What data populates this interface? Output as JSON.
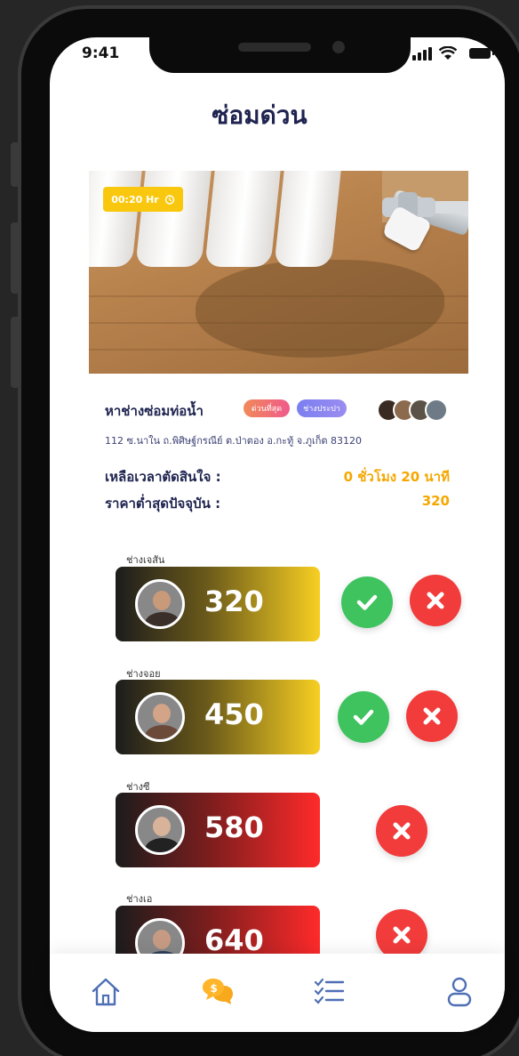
{
  "status": {
    "time": "9:41"
  },
  "header": {
    "title": "ซ่อมด่วน"
  },
  "hero": {
    "timer": "00:20 Hr"
  },
  "job": {
    "title": "หาช่างซ่อมท่อน้ำ",
    "tags": [
      "ด่วนที่สุด",
      "ช่างประปา"
    ],
    "address": "112 ซ.นาใน ถ.พิศิษฐ์กรณีย์ ต.ป่าตอง อ.กะทู้ จ.ภูเก็ต 83120"
  },
  "info": {
    "time_left_label": "เหลือเวลาตัดสินใจ :",
    "time_left_value": "0 ชั่วโมง 20 นาที",
    "lowest_price_label": "ราคาต่ำสุดปัจจุบัน :",
    "lowest_price_value": "320"
  },
  "bids": [
    {
      "name": "ช่างเจสัน",
      "price": "320",
      "style": "gold",
      "can_accept": true
    },
    {
      "name": "ช่างจอย",
      "price": "450",
      "style": "gold",
      "can_accept": true
    },
    {
      "name": "ช่างซี",
      "price": "580",
      "style": "red",
      "can_accept": false
    },
    {
      "name": "ช่างเอ",
      "price": "640",
      "style": "red",
      "can_accept": false
    }
  ],
  "nav": {
    "items": [
      {
        "icon": "home-icon",
        "active": false
      },
      {
        "icon": "chat-bid-icon",
        "active": true
      },
      {
        "icon": "checklist-icon",
        "active": false
      },
      {
        "icon": "profile-icon",
        "active": false
      }
    ]
  },
  "colors": {
    "title": "#1f2450",
    "accent": "#f5a700",
    "accept": "#3fc35f",
    "reject": "#f23b3b",
    "nav_icon": "#4f6fb5"
  }
}
